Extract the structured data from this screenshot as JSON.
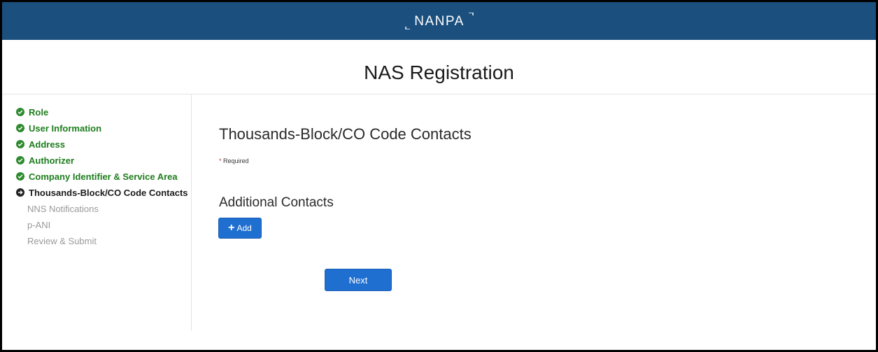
{
  "header": {
    "brand": "NANPA",
    "brand_color": "#1b4f7e"
  },
  "page": {
    "title": "NAS Registration"
  },
  "sidebar": {
    "steps": [
      {
        "label": "Role",
        "status": "complete",
        "icon": "check-circle-icon"
      },
      {
        "label": "User Information",
        "status": "complete",
        "icon": "check-circle-icon"
      },
      {
        "label": "Address",
        "status": "complete",
        "icon": "check-circle-icon"
      },
      {
        "label": "Authorizer",
        "status": "complete",
        "icon": "check-circle-icon"
      },
      {
        "label": "Company Identifier & Service Area",
        "status": "complete",
        "icon": "check-circle-icon"
      },
      {
        "label": "Thousands-Block/CO Code Contacts",
        "status": "current",
        "icon": "arrow-circle-icon"
      },
      {
        "label": "NNS Notifications",
        "status": "pending"
      },
      {
        "label": "p-ANI",
        "status": "pending"
      },
      {
        "label": "Review & Submit",
        "status": "pending"
      }
    ]
  },
  "main": {
    "heading": "Thousands-Block/CO Code Contacts",
    "required_star": "*",
    "required_label": "Required",
    "additional_heading": "Additional Contacts",
    "add_button_label": "Add",
    "add_icon": "plus-icon",
    "next_button_label": "Next"
  },
  "colors": {
    "complete": "#1e7d1e",
    "current": "#1a1a1a",
    "pending": "#9a9a9a",
    "primary_button": "#1f6fd1",
    "required_star": "#c23934"
  }
}
